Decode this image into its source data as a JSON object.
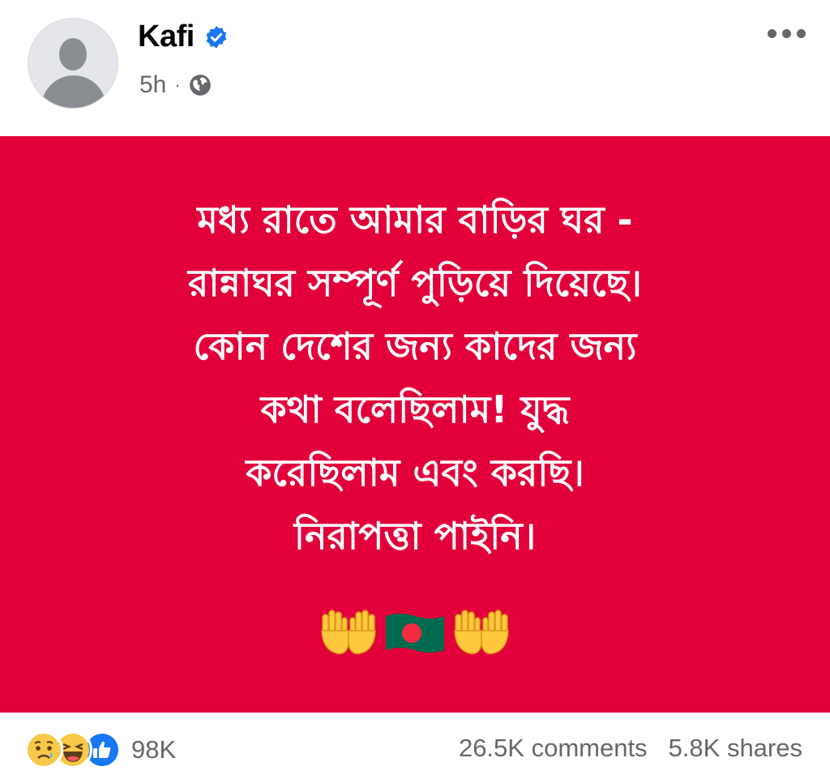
{
  "post": {
    "author": "Kafi",
    "time": "5h",
    "dot": "·",
    "text_lines": [
      "মধ্য রাতে আমার বাড়ির ঘর -",
      "রান্নাঘর সম্পূর্ণ পুড়িয়ে দিয়েছে।",
      "কোন দেশের জন্য কাদের জন্য",
      "কথা বলেছিলাম! যুদ্ধ",
      "করেছিলাম এবং করছি।",
      "নিরাপত্তা পাইনি।"
    ],
    "emoji": [
      "open-hands",
      "bangladesh-flag",
      "open-hands"
    ],
    "background_color": "#e2003a"
  },
  "footer": {
    "reactions": [
      "sad",
      "haha",
      "like"
    ],
    "reaction_count": "98K",
    "comments": "26.5K comments",
    "shares": "5.8K shares"
  },
  "icons": {
    "verified": "verified-badge-icon",
    "audience": "globe-icon",
    "menu": "more-options-icon"
  }
}
